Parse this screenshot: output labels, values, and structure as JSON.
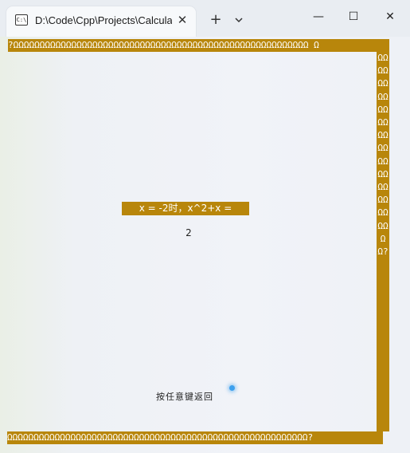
{
  "window": {
    "tab_title": "D:\\Code\\Cpp\\Projects\\Calcula",
    "tab_icon_text": "C:\\",
    "controls": {
      "close_tab": "✕",
      "new_tab": "+",
      "tab_menu": "chevron-down",
      "minimize": "—",
      "maximize": "☐",
      "close": "✕"
    }
  },
  "console": {
    "border_top": "?ΩΩΩΩΩΩΩΩΩΩΩΩΩΩΩΩΩΩΩΩΩΩΩΩΩΩΩΩΩΩΩΩΩΩΩΩΩΩΩΩΩΩΩΩΩΩΩΩΩΩΩΩΩΩΩΩ Ω",
    "border_right": "ΩΩΩΩΩΩΩΩΩΩΩΩΩΩΩΩΩΩΩΩΩΩΩΩΩΩΩΩΩΩ?",
    "border_bottom": "ΩΩΩΩΩΩΩΩΩΩΩΩΩΩΩΩΩΩΩΩΩΩΩΩΩΩΩΩΩΩΩΩΩΩΩΩΩΩΩΩΩΩΩΩΩΩΩΩΩΩΩΩΩΩΩΩΩ?",
    "equation": "x = -2时，x^2+x =",
    "result": "2",
    "prompt": "按任意键返回",
    "border_color": "#b8860b",
    "text_color": "#ffffff"
  }
}
